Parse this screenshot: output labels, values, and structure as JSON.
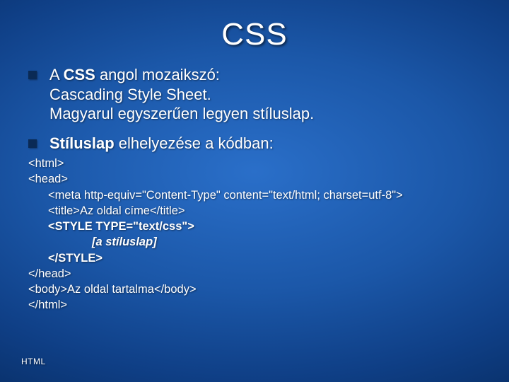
{
  "title": "CSS",
  "bullets": [
    {
      "prefix": "A ",
      "bold": "CSS",
      "rest_line1": " angol mozaikszó:",
      "line2": "Cascading Style Sheet.",
      "line3": "Magyarul egyszerűen legyen stíluslap."
    },
    {
      "bold": "Stíluslap",
      "rest": " elhelyezése a kódban:"
    }
  ],
  "code": {
    "l1": "<html>",
    "l2": "<head>",
    "l3": "<meta http-equiv=\"Content-Type\" content=\"text/html; charset=utf-8\">",
    "l4": "<title>Az oldal címe</title>",
    "l5": "<STYLE TYPE=\"text/css\">",
    "l6": "[a stíluslap]",
    "l7": "</STYLE>",
    "l8": "</head>",
    "l9": "<body>Az oldal tartalma</body>",
    "l10": "</html>"
  },
  "footer": "HTML"
}
